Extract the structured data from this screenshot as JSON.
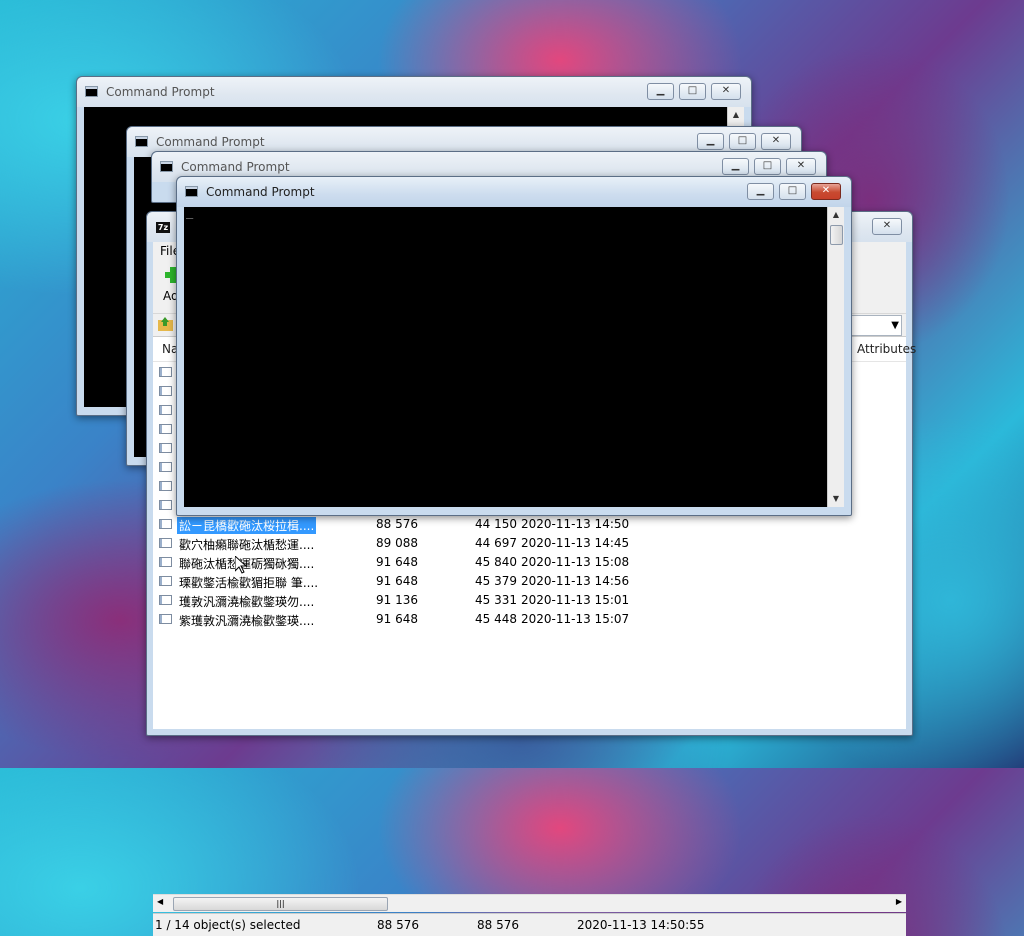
{
  "windows": {
    "cmd1": {
      "title": "Command Prompt"
    },
    "cmd2": {
      "title": "Command Prompt"
    },
    "cmd3": {
      "title": "Command Prompt"
    },
    "cmd4": {
      "title": "Command Prompt",
      "cursor": "_"
    },
    "zip": {
      "icon_text": "7z",
      "menu_first": "File",
      "toolbar_add": "Add",
      "headers": {
        "name": "Name",
        "attributes": "Attributes"
      },
      "files": [
        {
          "name": "訟ㄧ昆橋歡砤汰桜拉楫....",
          "size": "88 576",
          "packed": "44 150",
          "modified": "2020-11-13 14:50",
          "selected": true
        },
        {
          "name": "歡穴柚癩聯砤汰楯愁運....",
          "size": "89 088",
          "packed": "44 697",
          "modified": "2020-11-13 14:45",
          "selected": false
        },
        {
          "name": "聯砤汰楯愁運砺獨砯獨....",
          "size": "91 648",
          "packed": "45 840",
          "modified": "2020-11-13 15:08",
          "selected": false
        },
        {
          "name": "瑮歡鐅活楡歡猸拒聯 筆....",
          "size": "91 648",
          "packed": "45 379",
          "modified": "2020-11-13 14:56",
          "selected": false
        },
        {
          "name": "瓁敦汎瀰澆楡歡鐅瑛勿....",
          "size": "91 136",
          "packed": "45 331",
          "modified": "2020-11-13 15:01",
          "selected": false
        },
        {
          "name": "紫瓁敦汎瀰澆楡歡鐅瑛....",
          "size": "91 648",
          "packed": "45 448",
          "modified": "2020-11-13 15:07",
          "selected": false
        }
      ],
      "status": {
        "selection": "1 / 14 object(s) selected",
        "size": "88 576",
        "packed": "88 576",
        "modified": "2020-11-13 14:50:55"
      }
    }
  },
  "controls": {
    "minimize": "▁",
    "maximize": "□",
    "close": "✕"
  },
  "colors": {
    "selection": "#3399ff",
    "close_active": "#c84a30",
    "console_bg": "#000000"
  }
}
